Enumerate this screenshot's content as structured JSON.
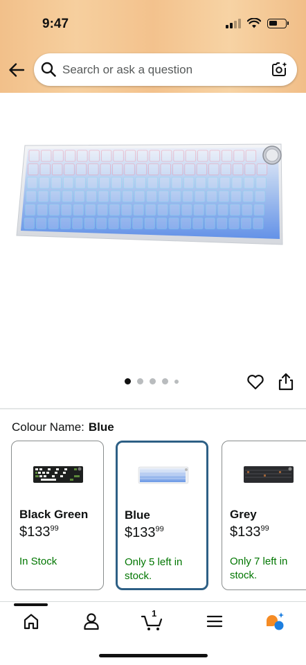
{
  "status_bar": {
    "time": "9:47"
  },
  "search": {
    "placeholder": "Search or ask a question"
  },
  "product": {
    "image_dots": {
      "count": 5,
      "active_index": 0
    }
  },
  "variation": {
    "label": "Colour Name:",
    "selected_value": "Blue",
    "options": [
      {
        "name": "Black Green",
        "price_whole": "$133",
        "price_fraction": "99",
        "stock": "In Stock"
      },
      {
        "name": "Blue",
        "price_whole": "$133",
        "price_fraction": "99",
        "stock": "Only 5 left in stock."
      },
      {
        "name": "Grey",
        "price_whole": "$133",
        "price_fraction": "99",
        "stock": "Only 7 left in stock."
      }
    ]
  },
  "bottom_nav": {
    "items": [
      "home-icon",
      "account-icon",
      "cart-icon",
      "menu-icon",
      "rufus-icon"
    ],
    "cart_count": "1"
  },
  "colors": {
    "header_gradient": "#f3c28d",
    "selected_border": "#2d5f85",
    "in_stock_green": "#007600"
  }
}
